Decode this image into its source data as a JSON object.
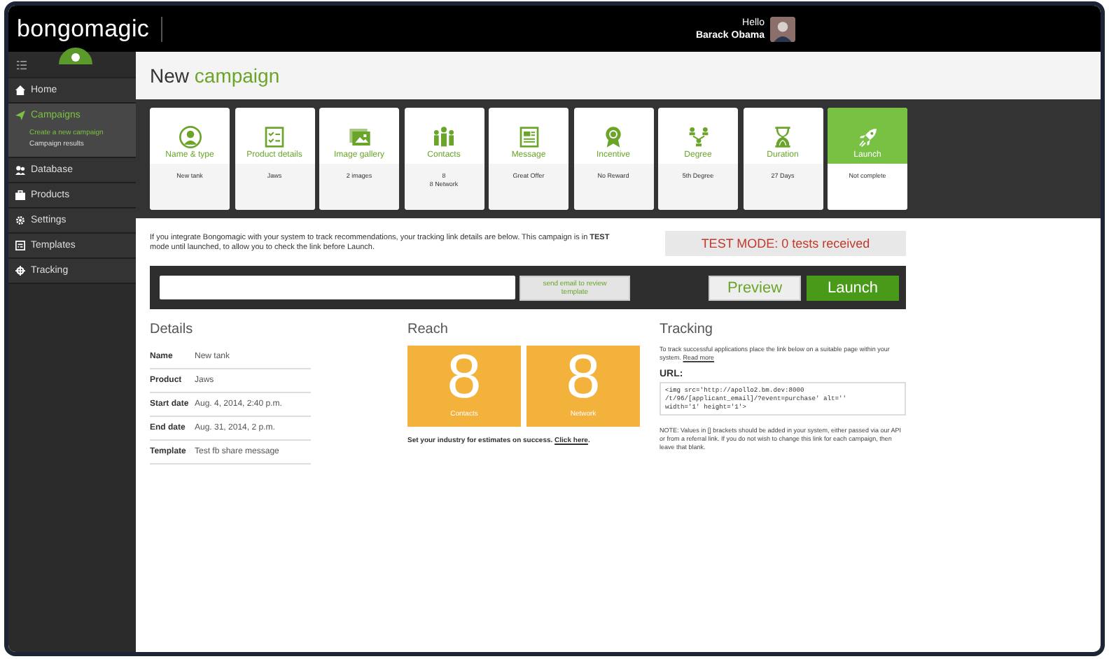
{
  "header": {
    "logo": "bongomagic",
    "greeting": "Hello",
    "user": "Barack Obama"
  },
  "sidebar": {
    "items": [
      {
        "label": "Home",
        "selected": false
      },
      {
        "label": "Campaigns",
        "selected": true,
        "children": [
          {
            "label": "Create a new campaign",
            "selected": true
          },
          {
            "label": "Campaign results",
            "selected": false
          }
        ]
      },
      {
        "label": "Database",
        "selected": false
      },
      {
        "label": "Products",
        "selected": false
      },
      {
        "label": "Settings",
        "selected": false
      },
      {
        "label": "Templates",
        "selected": false
      },
      {
        "label": "Tracking",
        "selected": false
      }
    ]
  },
  "page": {
    "title": "New **campaign**"
  },
  "steps": [
    {
      "kind": "step",
      "label": "Name & type",
      "value": [
        "New tank"
      ]
    },
    {
      "kind": "step",
      "label": "Product details",
      "value": [
        "Jaws"
      ]
    },
    {
      "kind": "step",
      "label": "Image gallery",
      "value": [
        "2 images"
      ]
    },
    {
      "kind": "step",
      "label": "Contacts",
      "value": [
        "8",
        "8 Network"
      ]
    },
    {
      "kind": "step",
      "label": "Message",
      "value": [
        "Great Offer"
      ]
    },
    {
      "kind": "step",
      "label": "Incentive",
      "value": [
        "No Reward"
      ]
    },
    {
      "kind": "step",
      "label": "Degree",
      "value": [
        "5th Degree"
      ]
    },
    {
      "kind": "step",
      "label": "Duration",
      "value": [
        "27 Days"
      ]
    },
    {
      "kind": "action",
      "label": "Launch",
      "value": [
        "Not complete"
      ]
    }
  ],
  "intro": "If you integrate Bongomagic with your system to track recommendations, your tracking link details are below. This campaign is in **TEST** mode until launched, to allow you to check the link before Launch.",
  "test_mode": "TEST MODE: 0 tests received",
  "toolbar": {
    "email_button": "send email to review template",
    "preview_button": "Preview",
    "launch_button": "Launch"
  },
  "details": {
    "heading": "Details",
    "rows": [
      {
        "label": "Name",
        "value": "New tank"
      },
      {
        "label": "Product",
        "value": "Jaws"
      },
      {
        "label": "Start date",
        "value": "Aug. 4, 2014, 2:40 p.m."
      },
      {
        "label": "End date",
        "value": "Aug. 31, 2014, 2 p.m."
      },
      {
        "label": "Template",
        "value": "Test fb share message"
      }
    ]
  },
  "reach": {
    "heading": "Reach",
    "tiles": [
      {
        "number": "8",
        "label": "Contacts"
      },
      {
        "number": "8",
        "label": "Network"
      }
    ],
    "note": "**Set your industry for estimates on success.**",
    "link": "Click here",
    "end": "."
  },
  "tracking": {
    "heading": "Tracking",
    "intro": "To track successful applications place the link below on a suitable page within your system.",
    "link": "Read more",
    "url_label": "URL:",
    "code": "<img src='http://apollo2.bm.dev:8000\n/t/96/[applicant_email]/?event=purchase' alt=''\nwidth='1' height='1'>",
    "note": "NOTE: Values in [] brackets should be added in your system, either passed via our API or from a referral link. If you do not wish to change this link for each campaign, then leave that blank."
  }
}
